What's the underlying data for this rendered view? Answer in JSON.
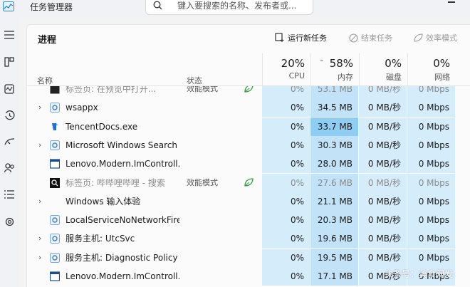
{
  "window": {
    "title": "任务管理器",
    "search_placeholder": "键入要搜索的名称、发布者或..."
  },
  "page": {
    "title": "进程"
  },
  "toolbar": {
    "run_new_task": "运行新任务",
    "end_task": "结束任务",
    "efficiency_mode": "效率模式"
  },
  "columns": {
    "name": "名称",
    "status": "状态",
    "cpu_pct": "20%",
    "cpu": "CPU",
    "mem_pct": "58%",
    "mem": "内存",
    "disk_pct": "0%",
    "disk": "磁盘",
    "net_pct": "0%",
    "net": "网络"
  },
  "rows": [
    {
      "name": "标签页: 在预览中打开...",
      "status": "效能模式",
      "cpu": "0%",
      "mem": "53.1 MB",
      "disk": "0 MB/秒",
      "net": "0 Mbps",
      "icon": "browser-icon",
      "expandable": false,
      "efficiency": true,
      "faded": true
    },
    {
      "name": "wsappx",
      "status": "",
      "cpu": "0%",
      "mem": "34.5 MB",
      "disk": "0 MB/秒",
      "net": "0 Mbps",
      "icon": "gear-icon",
      "expandable": true,
      "efficiency": false,
      "faded": false
    },
    {
      "name": "TencentDocs.exe",
      "status": "",
      "cpu": "0%",
      "mem": "33.7 MB",
      "disk": "0 MB/秒",
      "net": "0 Mbps",
      "icon": "tencent-docs-icon",
      "expandable": false,
      "efficiency": false,
      "faded": false,
      "highlight": true
    },
    {
      "name": "Microsoft Windows Search ...",
      "status": "",
      "cpu": "0%",
      "mem": "30.3 MB",
      "disk": "0 MB/秒",
      "net": "0 Mbps",
      "icon": "search-app-icon",
      "expandable": true,
      "efficiency": false,
      "faded": false
    },
    {
      "name": "Lenovo.Modern.ImControll...",
      "status": "",
      "cpu": "0%",
      "mem": "28.0 MB",
      "disk": "0 MB/秒",
      "net": "0 Mbps",
      "icon": "window-icon",
      "expandable": false,
      "efficiency": false,
      "faded": false
    },
    {
      "name": "标签页: 哔哔哩哔哩 - 搜索",
      "status": "效能模式",
      "cpu": "0%",
      "mem": "27.6 MB",
      "disk": "0 MB/秒",
      "net": "0 Mbps",
      "icon": "browser-search-icon",
      "expandable": false,
      "efficiency": true,
      "faded": true
    },
    {
      "name": "Windows 输入体验",
      "status": "",
      "cpu": "0%",
      "mem": "21.1 MB",
      "disk": "0 MB/秒",
      "net": "0 Mbps",
      "icon": "none",
      "expandable": true,
      "efficiency": false,
      "faded": false
    },
    {
      "name": "LocalServiceNoNetworkFire...",
      "status": "",
      "cpu": "0%",
      "mem": "20.3 MB",
      "disk": "0 MB/秒",
      "net": "0 Mbps",
      "icon": "gear-icon",
      "expandable": false,
      "efficiency": false,
      "faded": false
    },
    {
      "name": "服务主机: UtcSvc",
      "status": "",
      "cpu": "0%",
      "mem": "19.6 MB",
      "disk": "0 MB/秒",
      "net": "0 Mbps",
      "icon": "gear-icon",
      "expandable": true,
      "efficiency": false,
      "faded": false
    },
    {
      "name": "服务主机: Diagnostic Policy ...",
      "status": "",
      "cpu": "0%",
      "mem": "19.5 MB",
      "disk": "0 MB/秒",
      "net": "0 Mbps",
      "icon": "gear-icon",
      "expandable": true,
      "efficiency": false,
      "faded": false
    },
    {
      "name": "Lenovo.Modern.ImControll...",
      "status": "",
      "cpu": "0%",
      "mem": "17.1 MB",
      "disk": "0 MB/秒",
      "net": "0 Mbps",
      "icon": "window-icon",
      "expandable": false,
      "efficiency": false,
      "faded": false
    }
  ],
  "watermark": "头条号：美食网发",
  "colors": {
    "cell_light": "#d5ecfb",
    "cell_mem": "#c2e2f8",
    "cell_highlight": "#8fcdf3",
    "efficiency_green": "#3a9d4a"
  }
}
